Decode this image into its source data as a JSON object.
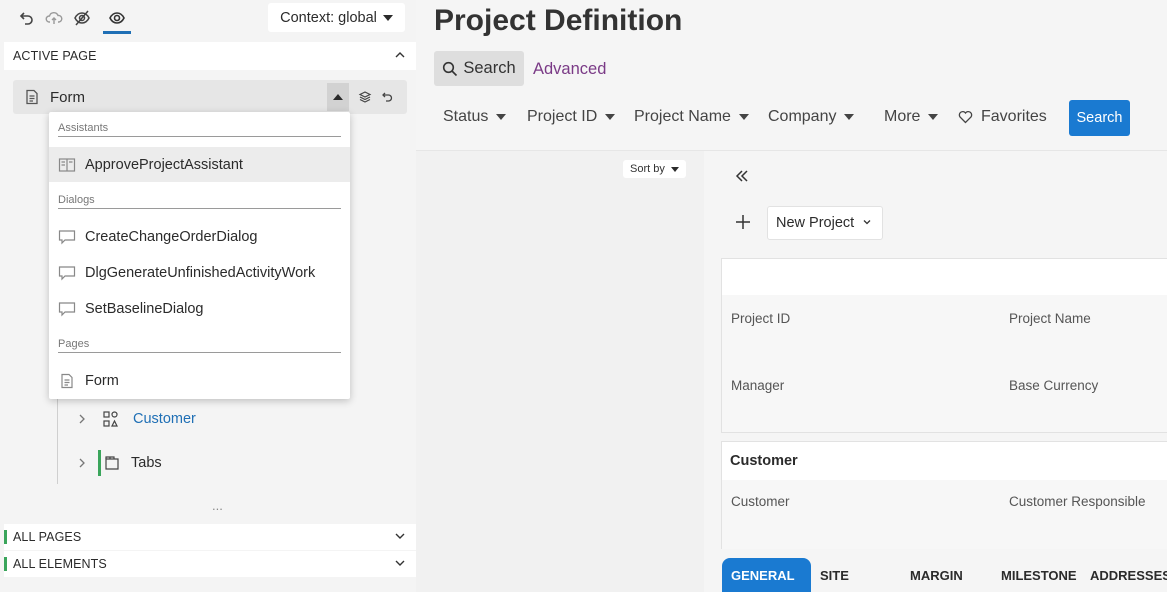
{
  "toolbar": {
    "context_label": "Context: global"
  },
  "left_panel": {
    "active_page_header": "ACTIVE PAGE",
    "active_page_selected": "Form",
    "dropdown": {
      "groups": [
        {
          "label": "Assistants",
          "items": [
            "ApproveProjectAssistant"
          ]
        },
        {
          "label": "Dialogs",
          "items": [
            "CreateChangeOrderDialog",
            "DlgGenerateUnfinishedActivityWork",
            "SetBaselineDialog"
          ]
        },
        {
          "label": "Pages",
          "items": [
            "Form"
          ]
        }
      ]
    },
    "tree": {
      "customer_label": "Customer",
      "tabs_label": "Tabs",
      "more": "..."
    },
    "all_pages_header": "ALL PAGES",
    "all_elements_header": "ALL ELEMENTS"
  },
  "main": {
    "title": "Project Definition",
    "search_tab": "Search",
    "advanced_tab": "Advanced",
    "filters": [
      "Status",
      "Project ID",
      "Project Name",
      "Company",
      "More"
    ],
    "favorites": "Favorites",
    "search_button": "Search",
    "sort_by": "Sort by",
    "new_project": "New Project",
    "fields": {
      "project_id": "Project ID",
      "project_name": "Project Name",
      "manager": "Manager",
      "base_currency": "Base Currency"
    },
    "customer_card": {
      "title": "Customer",
      "customer": "Customer",
      "customer_responsible": "Customer Responsible"
    },
    "tabs": [
      "GENERAL",
      "SITE",
      "MARGIN",
      "MILESTONE",
      "ADDRESSES"
    ]
  },
  "colors": {
    "accent_blue": "#1a7ad1",
    "advanced_purple": "#7a3a86",
    "tree_green": "#3aa55b",
    "customer_link": "#1f6fb5"
  }
}
